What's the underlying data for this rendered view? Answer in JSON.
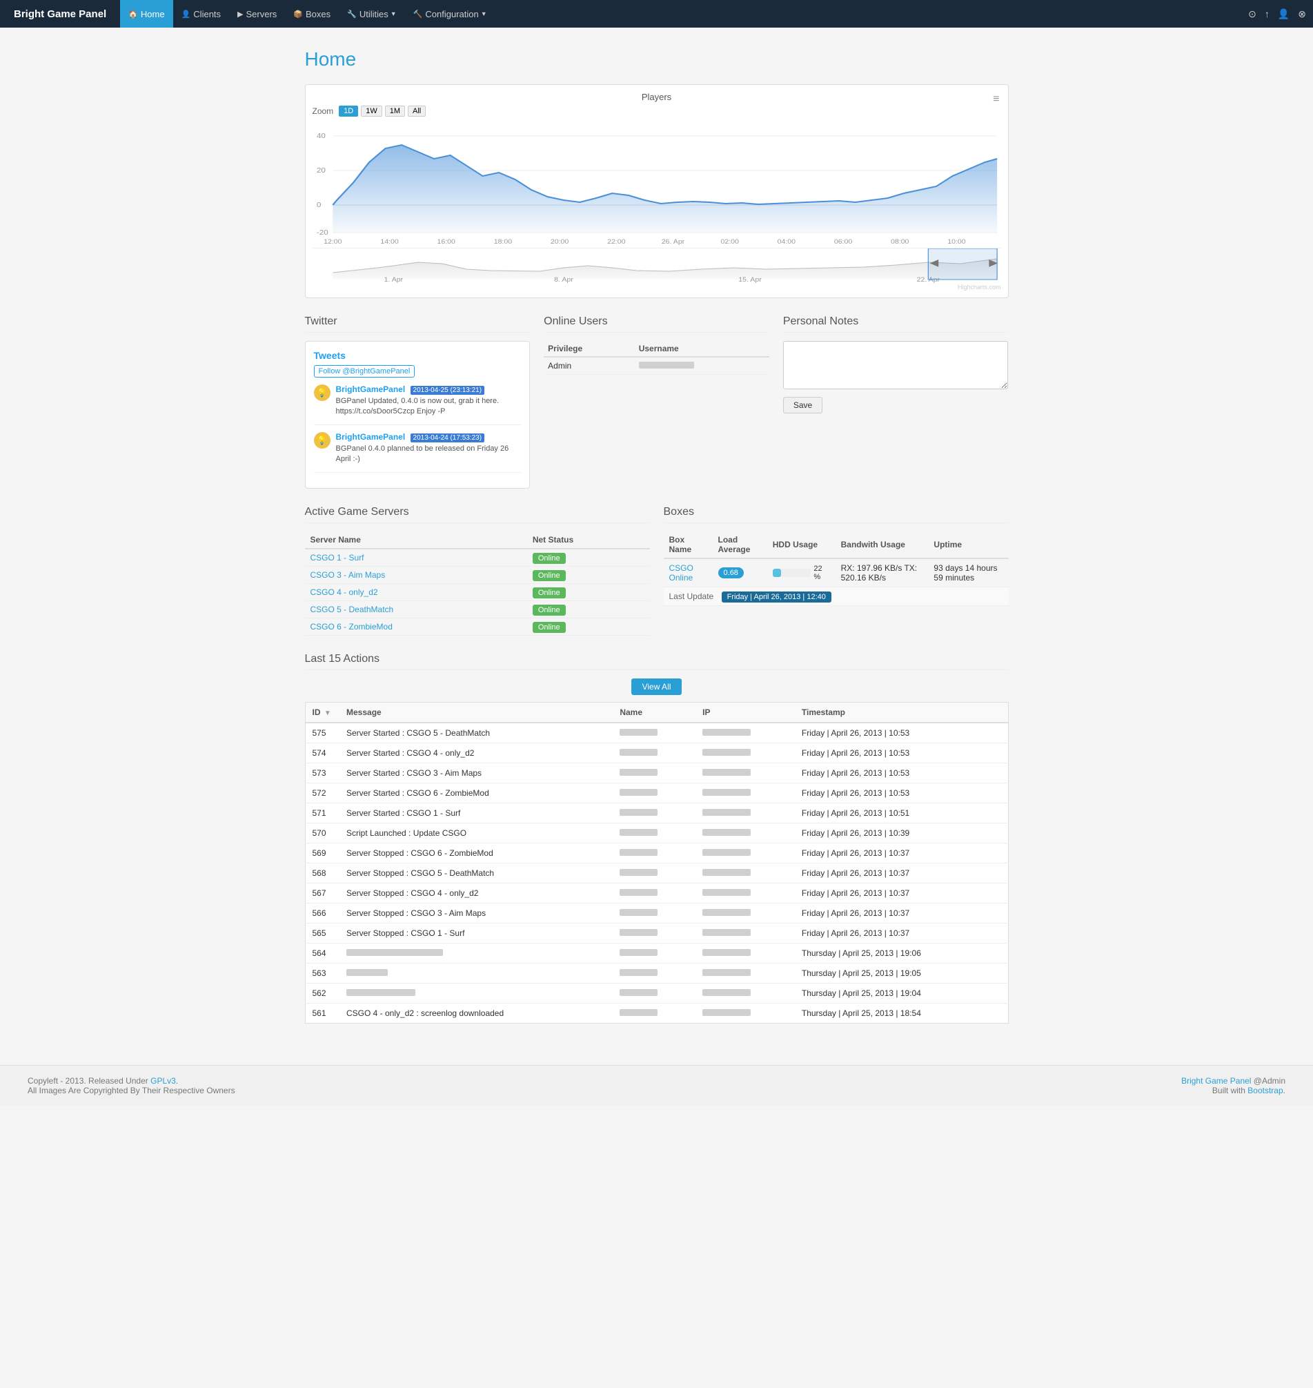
{
  "app": {
    "brand": "Bright Game Panel",
    "page_title": "Home"
  },
  "navbar": {
    "items": [
      {
        "label": "Home",
        "icon": "🏠",
        "active": true
      },
      {
        "label": "Clients",
        "icon": "👤",
        "active": false
      },
      {
        "label": "Servers",
        "icon": "▶",
        "active": false
      },
      {
        "label": "Boxes",
        "icon": "📦",
        "active": false
      },
      {
        "label": "Utilities",
        "icon": "🔧",
        "active": false,
        "dropdown": true
      },
      {
        "label": "Configuration",
        "icon": "🔨",
        "active": false,
        "dropdown": true
      }
    ],
    "right_icons": [
      "⊙",
      "↑",
      "👤",
      "⊗"
    ]
  },
  "chart": {
    "title": "Players",
    "zoom_options": [
      "1D",
      "1W",
      "1M",
      "All"
    ],
    "active_zoom": "1D",
    "y_labels": [
      "40",
      "20",
      "0",
      "-20"
    ],
    "x_labels": [
      "12:00",
      "14:00",
      "16:00",
      "18:00",
      "20:00",
      "22:00",
      "26. Apr",
      "02:00",
      "04:00",
      "06:00",
      "08:00",
      "10:00"
    ],
    "nav_labels": [
      "1. Apr",
      "8. Apr",
      "15. Apr",
      "22. Apr"
    ]
  },
  "twitter": {
    "section_title": "Twitter",
    "tweets_label": "Tweets",
    "follow_label": "Follow @BrightGamePanel",
    "tweets": [
      {
        "author": "BrightGamePanel",
        "date": "2013-04-25 (23:13:21)",
        "text": "BGPanel Updated, 0.4.0 is now out, grab it here. https://t.co/sDoor5Czcp Enjoy -P"
      },
      {
        "author": "BrightGamePanel",
        "date": "2013-04-24 (17:53:23)",
        "text": "BGPanel 0.4.0 planned to be released on Friday 26 April :-)"
      }
    ]
  },
  "online_users": {
    "section_title": "Online Users",
    "columns": [
      "Privilege",
      "Username"
    ],
    "rows": [
      {
        "privilege": "Admin",
        "username": ""
      }
    ]
  },
  "personal_notes": {
    "section_title": "Personal Notes",
    "placeholder": "",
    "save_label": "Save"
  },
  "active_servers": {
    "section_title": "Active Game Servers",
    "columns": [
      "Server Name",
      "Net Status"
    ],
    "rows": [
      {
        "name": "CSGO 1 - Surf",
        "status": "Online"
      },
      {
        "name": "CSGO 3 - Aim Maps",
        "status": "Online"
      },
      {
        "name": "CSGO 4 - only_d2",
        "status": "Online"
      },
      {
        "name": "CSGO 5 - DeathMatch",
        "status": "Online"
      },
      {
        "name": "CSGO 6 - ZombieMod",
        "status": "Online"
      }
    ]
  },
  "boxes": {
    "section_title": "Boxes",
    "columns": [
      "Box Name",
      "Load Average",
      "HDD Usage",
      "Bandwith Usage",
      "Uptime"
    ],
    "rows": [
      {
        "name": "CSGO Online",
        "load": "0.68",
        "hdd_pct": 22,
        "hdd_label": "22 %",
        "bandwidth": "RX: 197.96 KB/s   TX: 520.16 KB/s",
        "uptime": "93 days 14 hours 59 minutes"
      }
    ],
    "last_update_label": "Last Update",
    "last_update_value": "Friday | April 26, 2013 | 12:40"
  },
  "actions": {
    "section_title": "Last 15 Actions",
    "view_all_label": "View All",
    "columns": [
      "ID",
      "Message",
      "Name",
      "IP",
      "Timestamp"
    ],
    "rows": [
      {
        "id": "575",
        "message": "Server Started : CSGO 5 - DeathMatch",
        "name": "",
        "ip": "",
        "timestamp": "Friday | April 26, 2013 | 10:53"
      },
      {
        "id": "574",
        "message": "Server Started : CSGO 4 - only_d2",
        "name": "",
        "ip": "",
        "timestamp": "Friday | April 26, 2013 | 10:53"
      },
      {
        "id": "573",
        "message": "Server Started : CSGO 3 - Aim Maps",
        "name": "",
        "ip": "",
        "timestamp": "Friday | April 26, 2013 | 10:53"
      },
      {
        "id": "572",
        "message": "Server Started : CSGO 6 - ZombieMod",
        "name": "",
        "ip": "",
        "timestamp": "Friday | April 26, 2013 | 10:53"
      },
      {
        "id": "571",
        "message": "Server Started : CSGO 1 - Surf",
        "name": "",
        "ip": "",
        "timestamp": "Friday | April 26, 2013 | 10:51"
      },
      {
        "id": "570",
        "message": "Script Launched : Update CSGO",
        "name": "",
        "ip": "",
        "timestamp": "Friday | April 26, 2013 | 10:39"
      },
      {
        "id": "569",
        "message": "Server Stopped : CSGO 6 - ZombieMod",
        "name": "",
        "ip": "",
        "timestamp": "Friday | April 26, 2013 | 10:37"
      },
      {
        "id": "568",
        "message": "Server Stopped : CSGO 5 - DeathMatch",
        "name": "",
        "ip": "",
        "timestamp": "Friday | April 26, 2013 | 10:37"
      },
      {
        "id": "567",
        "message": "Server Stopped : CSGO 4 - only_d2",
        "name": "",
        "ip": "",
        "timestamp": "Friday | April 26, 2013 | 10:37"
      },
      {
        "id": "566",
        "message": "Server Stopped : CSGO 3 - Aim Maps",
        "name": "",
        "ip": "",
        "timestamp": "Friday | April 26, 2013 | 10:37"
      },
      {
        "id": "565",
        "message": "Server Stopped : CSGO 1 - Surf",
        "name": "",
        "ip": "",
        "timestamp": "Friday | April 26, 2013 | 10:37"
      },
      {
        "id": "564",
        "message": "",
        "name": "",
        "ip": "",
        "timestamp": "Thursday | April 25, 2013 | 19:06"
      },
      {
        "id": "563",
        "message": "",
        "name": "",
        "ip": "",
        "timestamp": "Thursday | April 25, 2013 | 19:05"
      },
      {
        "id": "562",
        "message": "",
        "name": "",
        "ip": "",
        "timestamp": "Thursday | April 25, 2013 | 19:04"
      },
      {
        "id": "561",
        "message": "CSGO 4 - only_d2 : screenlog downloaded",
        "name": "",
        "ip": "",
        "timestamp": "Thursday | April 25, 2013 | 18:54"
      }
    ]
  },
  "footer": {
    "left1": "Copyleft - 2013. Released Under ",
    "license": "GPLv3",
    "left2": ".",
    "left3": "All Images Are Copyrighted By Their Respective Owners",
    "right1": "Bright Game Panel",
    "right2": " @Admin",
    "right3": "Built with ",
    "right4": "Bootstrap",
    "right5": "."
  }
}
